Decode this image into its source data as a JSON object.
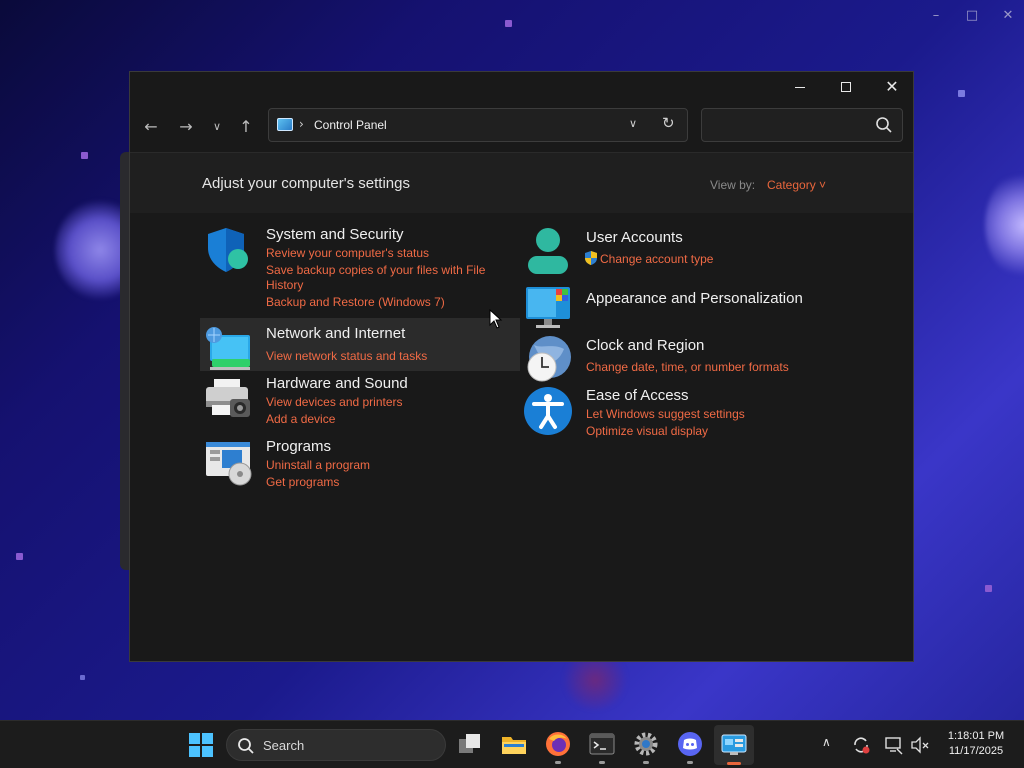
{
  "window": {
    "breadcrumb": "Control Panel",
    "search_placeholder": "",
    "heading": "Adjust your computer's settings",
    "view_by_label": "View by:",
    "view_by_value": "Category ˅"
  },
  "categories_left": [
    {
      "title": "System and Security",
      "links": [
        "Review your computer's status",
        "Save backup copies of your files with File",
        "History",
        "Backup and Restore (Windows 7)"
      ],
      "icon": "shield-icon"
    },
    {
      "title": "Network and Internet",
      "links": [
        "View network status and tasks"
      ],
      "icon": "network-icon"
    },
    {
      "title": "Hardware and Sound",
      "links": [
        "View devices and printers",
        "Add a device"
      ],
      "icon": "printer-icon"
    },
    {
      "title": "Programs",
      "links": [
        "Uninstall a program",
        "Get programs"
      ],
      "icon": "programs-icon"
    }
  ],
  "categories_right": [
    {
      "title": "User Accounts",
      "links": [
        "Change account type"
      ],
      "icon": "user-icon"
    },
    {
      "title": "Appearance and Personalization",
      "links": [],
      "icon": "monitor-icon"
    },
    {
      "title": "Clock and Region",
      "links": [
        "Change date, time, or number formats"
      ],
      "icon": "clock-globe-icon"
    },
    {
      "title": "Ease of Access",
      "links": [
        "Let Windows suggest settings",
        "Optimize visual display"
      ],
      "icon": "accessibility-icon"
    }
  ],
  "taskbar": {
    "search_label": "Search",
    "time": "1:18:01 PM",
    "date": "11/17/2025",
    "accent": "#e8663c"
  }
}
